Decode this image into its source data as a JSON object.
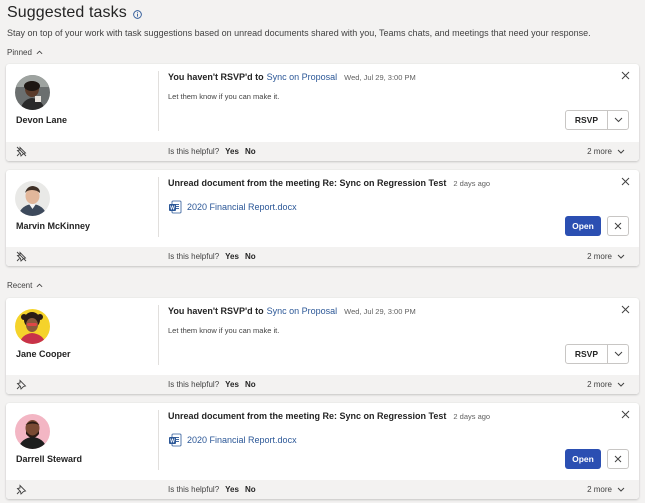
{
  "header": {
    "title": "Suggested tasks",
    "subtitle": "Stay on top of your work with task suggestions based on unread documents shared with you, Teams chats, and meetings that need your response."
  },
  "sections": {
    "pinned": "Pinned",
    "recent": "Recent"
  },
  "cards": [
    {
      "person": "Devon Lane",
      "lead": "You haven't RSVP'd to",
      "link": "Sync on Proposal",
      "meta": "Wed, Jul 29, 3:00 PM",
      "desc": "Let them know if you can make it.",
      "action": "RSVP",
      "helpful": "Is this helpful?",
      "yes": "Yes",
      "no": "No",
      "more": "2 more"
    },
    {
      "person": "Marvin McKinney",
      "lead": "Unread document from the meeting Re: Sync on Regression Test",
      "meta": "2 days ago",
      "doc": "2020 Financial Report.docx",
      "action": "Open",
      "helpful": "Is this helpful?",
      "yes": "Yes",
      "no": "No",
      "more": "2 more"
    },
    {
      "person": "Jane Cooper",
      "lead": "You haven't RSVP'd to",
      "link": "Sync on Proposal",
      "meta": "Wed, Jul 29, 3:00 PM",
      "desc": "Let them know if you can make it.",
      "action": "RSVP",
      "helpful": "Is this helpful?",
      "yes": "Yes",
      "no": "No",
      "more": "2 more"
    },
    {
      "person": "Darrell Steward",
      "lead": "Unread document from the meeting Re: Sync on Regression Test",
      "meta": "2 days ago",
      "doc": "2020 Financial Report.docx",
      "action": "Open",
      "helpful": "Is this helpful?",
      "yes": "Yes",
      "no": "No",
      "more": "2 more"
    }
  ],
  "colors": {
    "accent": "#2b4fb2",
    "link": "#2b5797",
    "background": "#f3f2f1"
  },
  "icons": [
    "info-icon",
    "chevron-up-icon",
    "close-icon",
    "chevron-down-icon",
    "word-doc-icon",
    "unpin-icon",
    "pin-icon"
  ]
}
